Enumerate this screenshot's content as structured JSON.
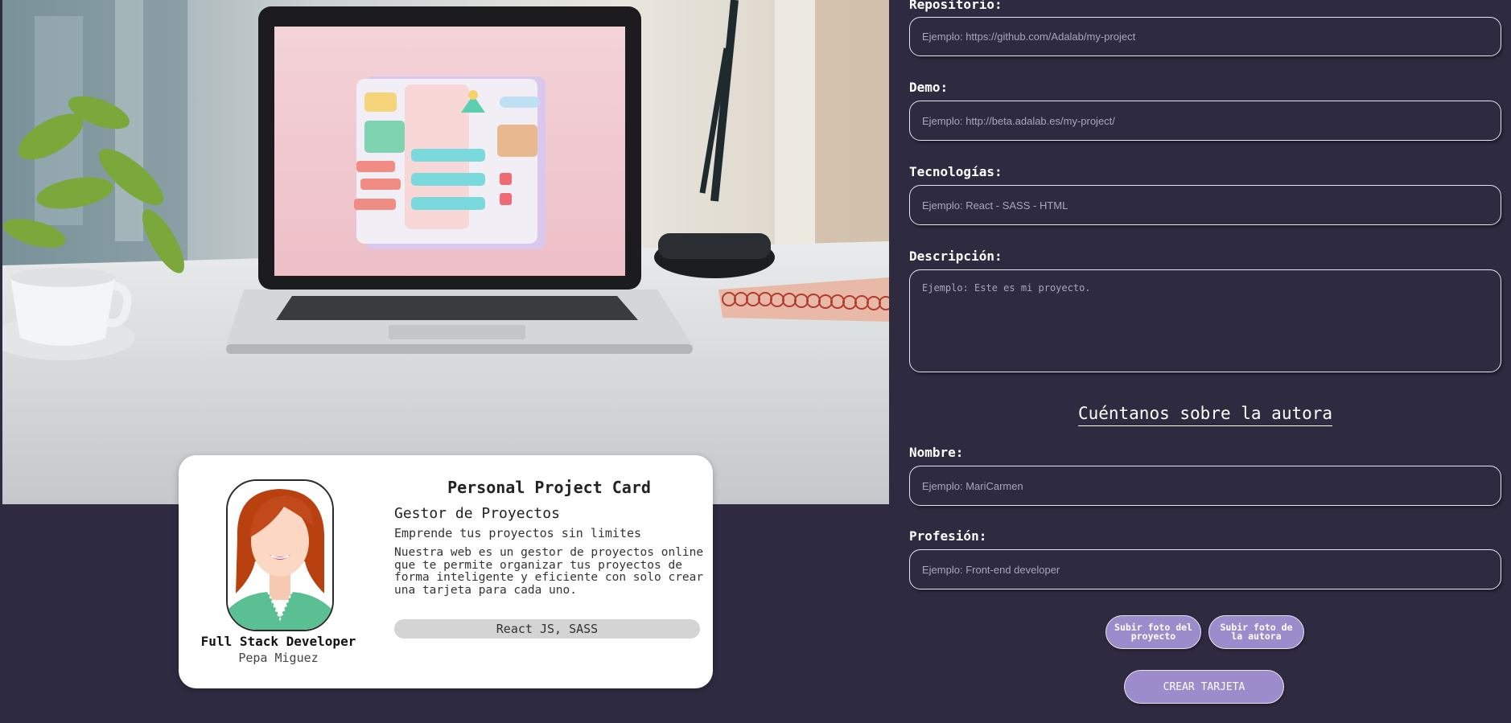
{
  "hero": {
    "image_alt": "laptop-on-desk-photo"
  },
  "card": {
    "title": "Personal Project Card",
    "subtitle": "Gestor de Proyectos",
    "slogan": "Emprende tus proyectos sin limites",
    "description": "Nuestra web es un gestor de proyectos online que te permite organizar tus proyectos de forma inteligente y eficiente con solo crear una tarjeta para cada uno.",
    "technologies": "React JS, SASS",
    "author_job": "Full Stack Developer",
    "author_name": "Pepa Miguez"
  },
  "form": {
    "repo": {
      "label": "Repositorio:",
      "placeholder": "Ejemplo: https://github.com/Adalab/my-project"
    },
    "demo": {
      "label": "Demo:",
      "placeholder": "Ejemplo: http://beta.adalab.es/my-project/"
    },
    "tech": {
      "label": "Tecnologías:",
      "placeholder": "Ejemplo: React - SASS - HTML"
    },
    "desc": {
      "label": "Descripción:",
      "placeholder": "Ejemplo: Este es mi proyecto."
    },
    "author_section_title": "Cuéntanos sobre la autora",
    "name": {
      "label": "Nombre:",
      "placeholder": "Ejemplo: MariCarmen"
    },
    "job": {
      "label": "Profesión:",
      "placeholder": "Ejemplo: Front-end developer"
    },
    "upload_project_label": "Subir foto del proyecto",
    "upload_author_label": "Subir foto de la autora",
    "create_label": "CREAR TARJETA"
  },
  "colors": {
    "background": "#2e2b40",
    "button": "#9d8ccc",
    "card": "#ffffff",
    "tech_pill": "#d4d4d4"
  }
}
